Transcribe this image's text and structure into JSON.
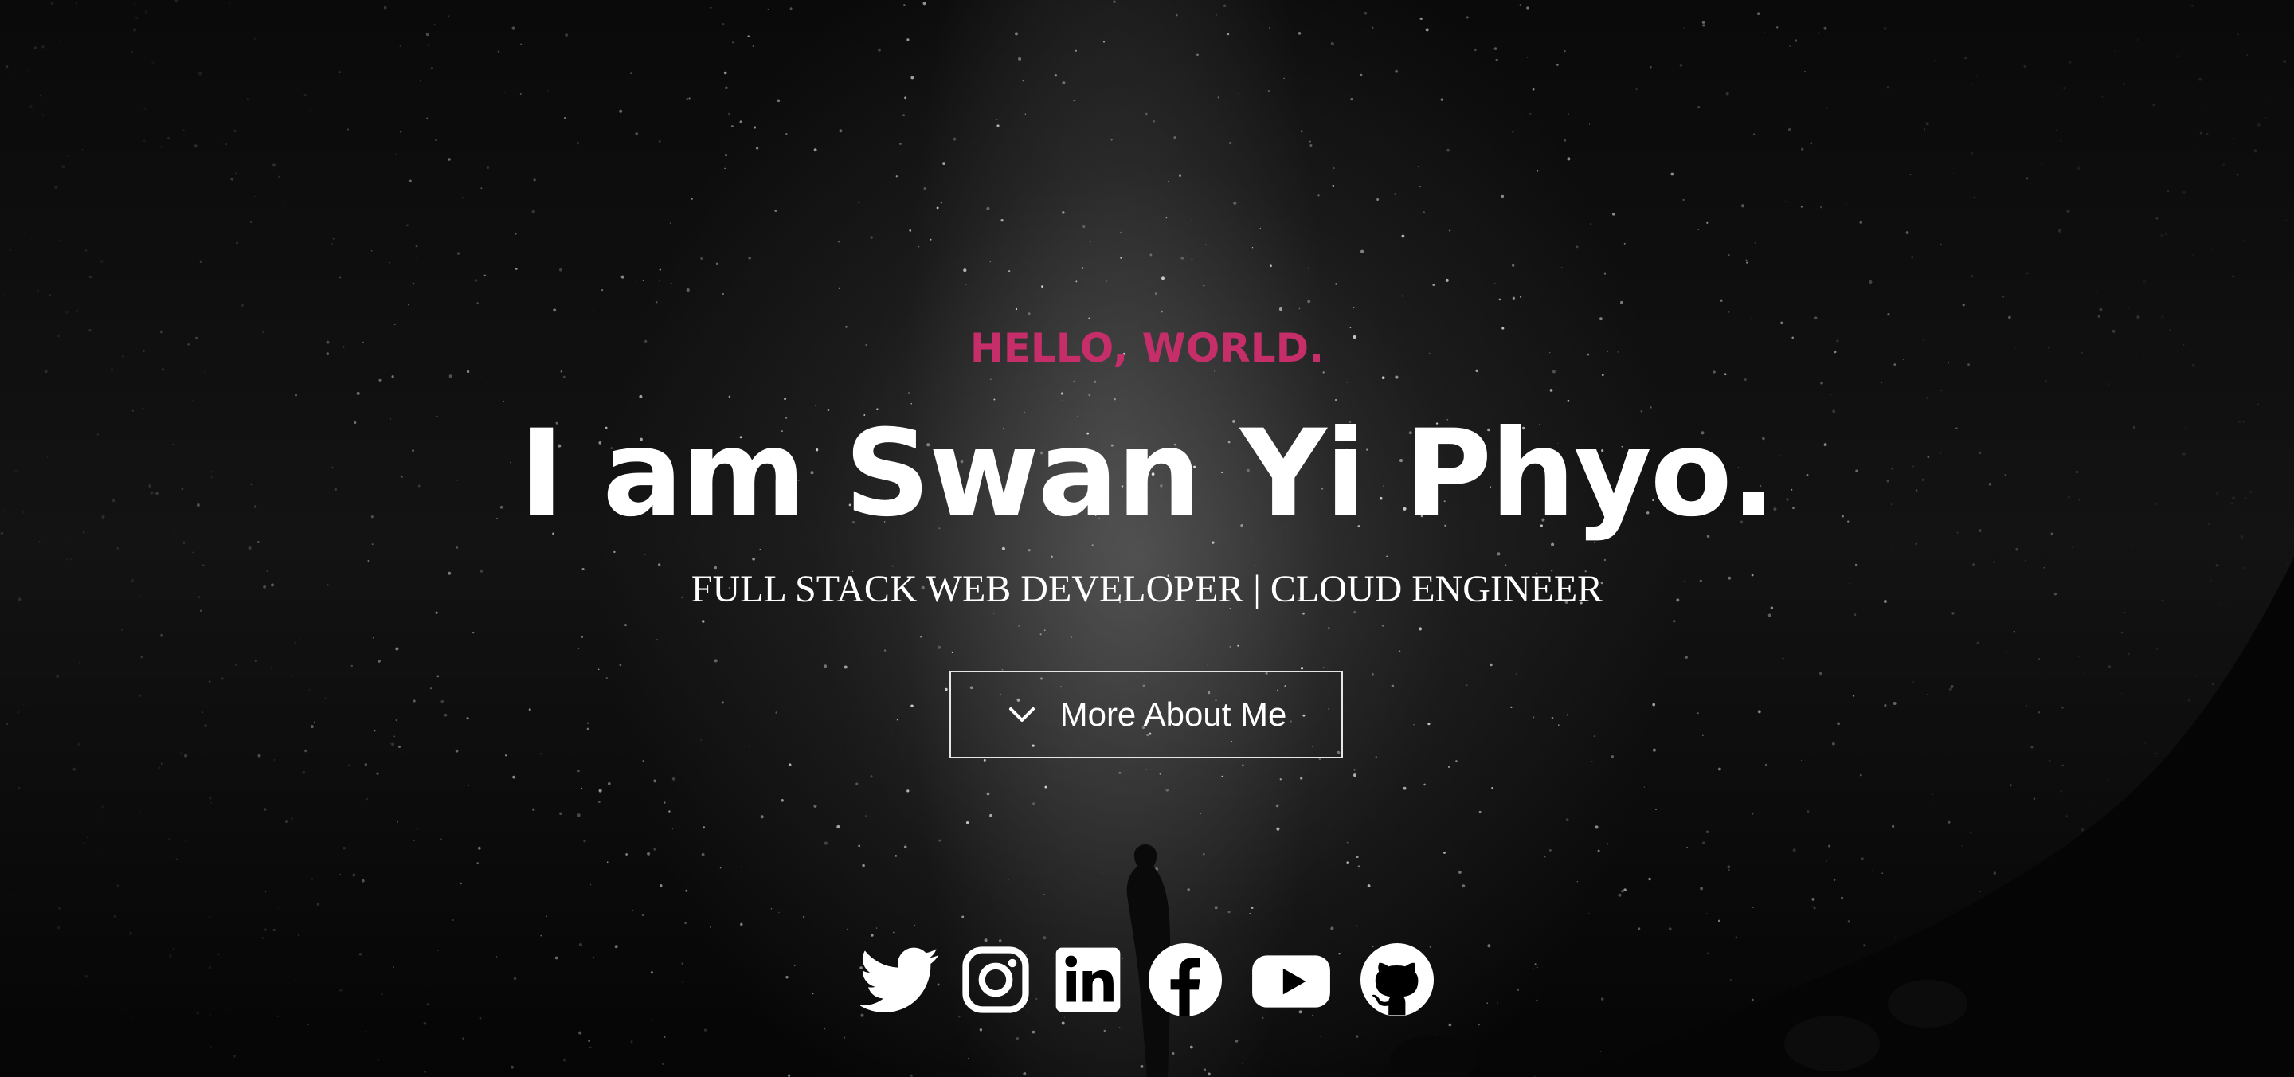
{
  "hero": {
    "greeting": "HELLO, WORLD.",
    "name": "I am Swan Yi Phyo.",
    "subtitle": "FULL STACK WEB DEVELOPER | CLOUD ENGINEER",
    "more_button": {
      "icon": "chevron-down-icon",
      "label": "More About Me"
    }
  },
  "socials": [
    {
      "name": "twitter",
      "icon": "twitter-icon"
    },
    {
      "name": "instagram",
      "icon": "instagram-icon"
    },
    {
      "name": "linkedin",
      "icon": "linkedin-icon"
    },
    {
      "name": "facebook",
      "icon": "facebook-icon"
    },
    {
      "name": "youtube",
      "icon": "youtube-icon"
    },
    {
      "name": "github",
      "icon": "github-icon"
    }
  ],
  "colors": {
    "accent": "#c62e6a",
    "text": "#ffffff",
    "background": "#000000"
  }
}
